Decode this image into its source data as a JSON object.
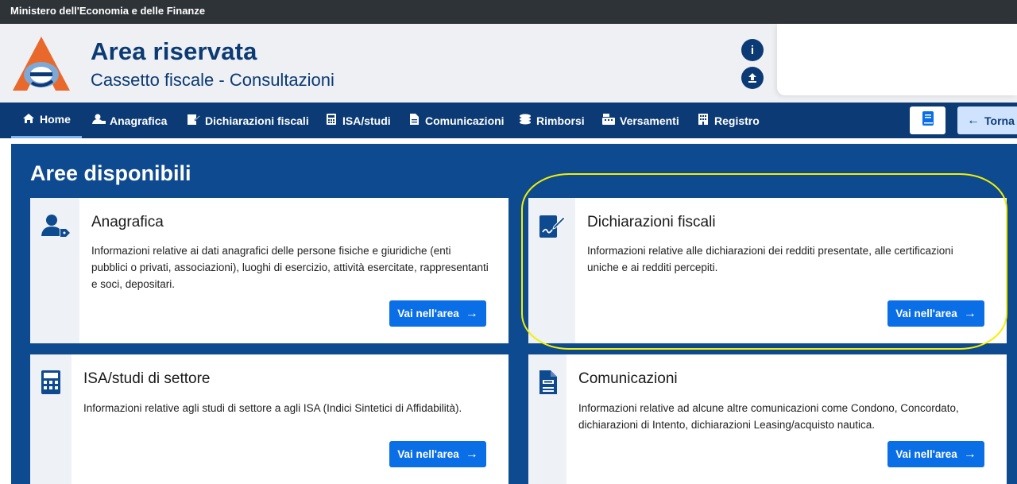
{
  "topbar": {
    "text": "Ministero dell'Economia e delle Finanze"
  },
  "header": {
    "title": "Area riservata",
    "subtitle": "Cassetto fiscale - Consultazioni",
    "info_icon": "info-icon",
    "upload_icon": "upload-icon"
  },
  "nav": {
    "items": [
      {
        "label": "Home",
        "icon": "home-icon",
        "active": true
      },
      {
        "label": "Anagrafica",
        "icon": "user-tag-icon"
      },
      {
        "label": "Dichiarazioni fiscali",
        "icon": "signature-icon"
      },
      {
        "label": "ISA/studi",
        "icon": "calculator-icon"
      },
      {
        "label": "Comunicazioni",
        "icon": "document-icon"
      },
      {
        "label": "Rimborsi",
        "icon": "coins-icon"
      },
      {
        "label": "Versamenti",
        "icon": "cash-register-icon"
      },
      {
        "label": "Registro",
        "icon": "building-icon"
      }
    ],
    "book_icon": "book-icon",
    "back_label": "Torna"
  },
  "main": {
    "title": "Aree disponibili",
    "cards": [
      {
        "title": "Anagrafica",
        "description": "Informazioni relative ai dati anagrafici delle persone fisiche e giuridiche (enti pubblici o privati, associazioni), luoghi di esercizio, attività esercitate, rappresentanti e soci, depositari.",
        "button": "Vai nell'area",
        "icon": "user-tag-icon"
      },
      {
        "title": "Dichiarazioni fiscali",
        "description": "Informazioni relative alle dichiarazioni dei redditi presentate, alle certificazioni uniche e ai redditi percepiti.",
        "button": "Vai nell'area",
        "icon": "signature-icon"
      },
      {
        "title": "ISA/studi di settore",
        "description": "Informazioni relative agli studi di settore a agli ISA (Indici Sintetici di Affidabilità).",
        "button": "Vai nell'area",
        "icon": "calculator-icon"
      },
      {
        "title": "Comunicazioni",
        "description": "Informazioni relative ad alcune altre comunicazioni come Condono, Concordato, dichiarazioni di Intento, dichiarazioni Leasing/acquisto nautica.",
        "button": "Vai nell'area",
        "icon": "document-icon"
      }
    ]
  },
  "colors": {
    "navy": "#0b3a74",
    "panel_blue": "#0e4a8f",
    "button_blue": "#0a6ee6",
    "highlight": "#f4f000"
  }
}
